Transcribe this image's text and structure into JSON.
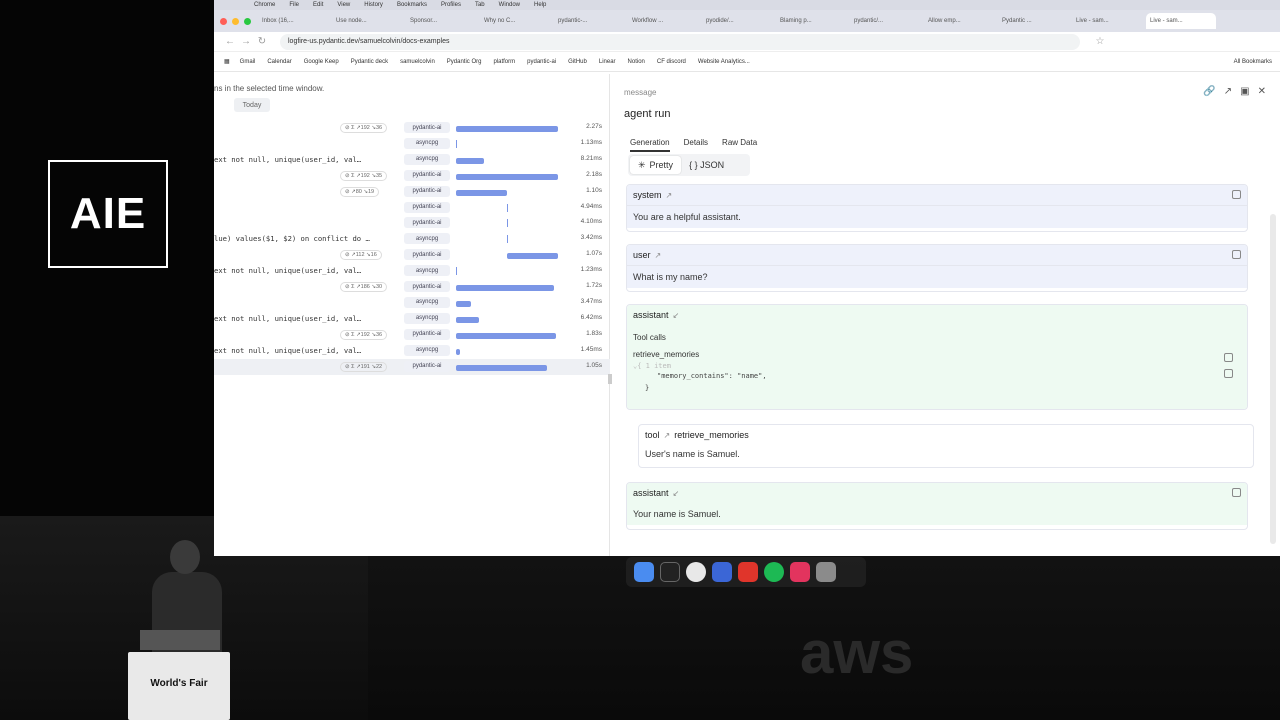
{
  "event": {
    "logo_text": "AIE",
    "podium_label": "World's Fair",
    "watermark": "aws"
  },
  "browser": {
    "menu_items": [
      "Chrome",
      "File",
      "Edit",
      "View",
      "History",
      "Bookmarks",
      "Profiles",
      "Tab",
      "Window",
      "Help"
    ],
    "tabs": [
      "Inbox (16,...",
      "Use node...",
      "Sponsor...",
      "Why no C...",
      "pydantic-...",
      "Workflow ...",
      "pyodide/...",
      "Blaming p...",
      "pydantic/...",
      "Allow emp...",
      "Pydantic ...",
      "Live - sam...",
      "Live - sam..."
    ],
    "active_tab_index": 12,
    "url": "logfire-us.pydantic.dev/samuelcolvin/docs-examples",
    "bookmarks": [
      "Gmail",
      "Calendar",
      "Google Keep",
      "Pydantic deck",
      "samuelcolvin",
      "Pydantic Org",
      "platform",
      "pydantic-ai",
      "GitHub",
      "Linear",
      "Notion",
      "CF discord",
      "Website Analytics..."
    ],
    "all_bookmarks": "All Bookmarks"
  },
  "trace": {
    "hint": "ns in the selected time window.",
    "today_label": "Today",
    "rows": [
      {
        "label": "",
        "badge": "⊘ Σ ↗192 ↘36",
        "tag": "pydantic-ai",
        "dur": "2.27s",
        "bar": [
          0.0,
          0.96
        ]
      },
      {
        "label": "",
        "badge": "",
        "tag": "asyncpg",
        "dur": "1.13ms",
        "tick": 0.0
      },
      {
        "label": "ext not null, unique(user_id, val…",
        "badge": "",
        "tag": "asyncpg",
        "dur": "8.21ms",
        "bar": [
          0.0,
          0.26
        ]
      },
      {
        "label": "",
        "badge": "⊘ Σ ↗192 ↘35",
        "tag": "pydantic-ai",
        "dur": "2.18s",
        "bar": [
          0.0,
          0.96
        ]
      },
      {
        "label": "",
        "badge": "⊘ ↗80 ↘19",
        "tag": "pydantic-ai",
        "dur": "1.10s",
        "bar": [
          0.0,
          0.48
        ]
      },
      {
        "label": "",
        "badge": "",
        "tag": "pydantic-ai",
        "dur": "4.94ms",
        "tick": 0.48
      },
      {
        "label": "",
        "badge": "",
        "tag": "pydantic-ai",
        "dur": "4.10ms",
        "tick": 0.48
      },
      {
        "label": "lue) values($1, $2) on conflict do …",
        "badge": "",
        "tag": "asyncpg",
        "dur": "3.42ms",
        "tick": 0.48
      },
      {
        "label": "",
        "badge": "⊘ ↗112 ↘16",
        "tag": "pydantic-ai",
        "dur": "1.07s",
        "bar": [
          0.48,
          0.96
        ]
      },
      {
        "label": "ext not null, unique(user_id, val…",
        "badge": "",
        "tag": "asyncpg",
        "dur": "1.23ms",
        "tick": 0.0
      },
      {
        "label": "",
        "badge": "⊘ Σ ↗186 ↘30",
        "tag": "pydantic-ai",
        "dur": "1.72s",
        "bar": [
          0.0,
          0.92
        ]
      },
      {
        "label": "",
        "badge": "",
        "tag": "asyncpg",
        "dur": "3.47ms",
        "bar": [
          0.0,
          0.14
        ]
      },
      {
        "label": "ext not null, unique(user_id, val…",
        "badge": "",
        "tag": "asyncpg",
        "dur": "6.42ms",
        "bar": [
          0.0,
          0.22
        ]
      },
      {
        "label": "",
        "badge": "⊘ Σ ↗192 ↘36",
        "tag": "pydantic-ai",
        "dur": "1.83s",
        "bar": [
          0.0,
          0.94
        ]
      },
      {
        "label": "ext not null, unique(user_id, val…",
        "badge": "",
        "tag": "asyncpg",
        "dur": "1.45ms",
        "bar": [
          0.0,
          0.04
        ]
      },
      {
        "label": "",
        "badge": "⊘ Σ ↗191 ↘22",
        "tag": "pydantic-ai",
        "dur": "1.05s",
        "bar": [
          0.0,
          0.86
        ],
        "selected": true
      }
    ]
  },
  "detail": {
    "section_label": "message",
    "title": "agent run",
    "subtabs": [
      "Generation",
      "Details",
      "Raw Data"
    ],
    "active_subtab": "Generation",
    "format_pretty": "Pretty",
    "format_json": "{ } JSON",
    "messages": {
      "system_role": "system",
      "system_text": "You are a helpful assistant.",
      "user_role": "user",
      "user_text": "What is my name?",
      "assistant_role": "assistant",
      "tool_calls_label": "Tool calls",
      "tool_call_name": "retrieve_memories",
      "tool_call_fold": "⌄{ 1 item",
      "tool_call_arg": "\"memory_contains\": \"name\",",
      "tool_call_close": "}",
      "tool_role": "tool",
      "tool_name": "retrieve_memories",
      "tool_text": "User's name is Samuel.",
      "assistant2_role": "assistant",
      "assistant2_text": "Your name is Samuel."
    }
  },
  "colors": {
    "bar": "#7b96e6",
    "system_bg": "#eef1fb",
    "assistant_bg": "#eefaf2"
  }
}
